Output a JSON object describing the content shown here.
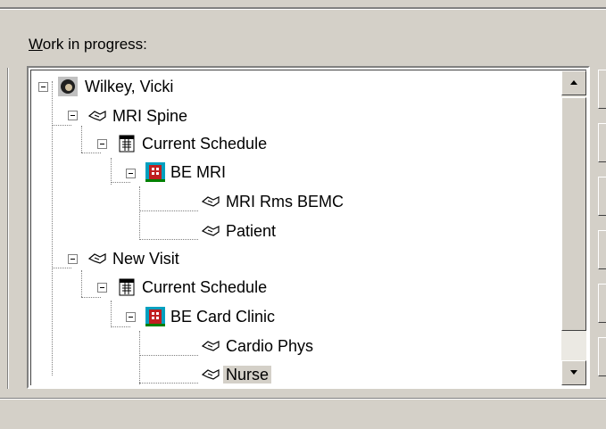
{
  "panel": {
    "label_accel": "W",
    "label_rest": "ork in progress:"
  },
  "tree": {
    "root": {
      "label": "Wilkey, Vicki",
      "icon": "patient-head-icon"
    },
    "visit1": {
      "label": "MRI Spine",
      "icon": "handshake-icon",
      "schedule": {
        "label": "Current Schedule",
        "icon": "calendar-icon"
      },
      "location": {
        "label": "BE MRI",
        "icon": "hospital-building-icon"
      },
      "children": [
        {
          "label": "MRI Rms BEMC",
          "icon": "handshake-icon"
        },
        {
          "label": "Patient",
          "icon": "handshake-icon"
        }
      ]
    },
    "visit2": {
      "label": "New Visit",
      "icon": "handshake-icon",
      "schedule": {
        "label": "Current Schedule",
        "icon": "calendar-icon"
      },
      "location": {
        "label": "BE Card Clinic",
        "icon": "hospital-building-icon"
      },
      "children": [
        {
          "label": "Cardio Phys",
          "icon": "handshake-icon"
        },
        {
          "label": "Nurse",
          "icon": "handshake-icon",
          "selected": true
        }
      ]
    }
  },
  "scrollbar": {
    "up_icon": "scroll-up-arrow-icon",
    "down_icon": "scroll-down-arrow-icon"
  }
}
